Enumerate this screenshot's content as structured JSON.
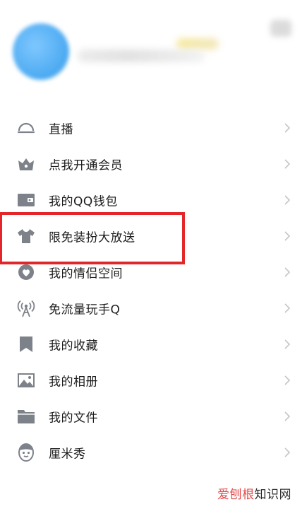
{
  "colors": {
    "icon_gray": "#7d828a",
    "chevron": "#c6c6c6",
    "highlight": "#e3262a"
  },
  "menu": {
    "items": [
      {
        "label": "直播",
        "icon": "live-dome-icon"
      },
      {
        "label": "点我开通会员",
        "icon": "vip-crown-icon"
      },
      {
        "label": "我的QQ钱包",
        "icon": "wallet-icon"
      },
      {
        "label": "限免装扮大放送",
        "icon": "tshirt-icon"
      },
      {
        "label": "我的情侣空间",
        "icon": "couple-space-icon"
      },
      {
        "label": "免流量玩手Q",
        "icon": "signal-tower-icon"
      },
      {
        "label": "我的收藏",
        "icon": "bookmark-icon"
      },
      {
        "label": "我的相册",
        "icon": "photo-album-icon"
      },
      {
        "label": "我的文件",
        "icon": "folder-icon"
      },
      {
        "label": "厘米秀",
        "icon": "cmshow-face-icon"
      }
    ]
  },
  "watermark": {
    "part1": "爱刨根",
    "part2": "知识网"
  }
}
